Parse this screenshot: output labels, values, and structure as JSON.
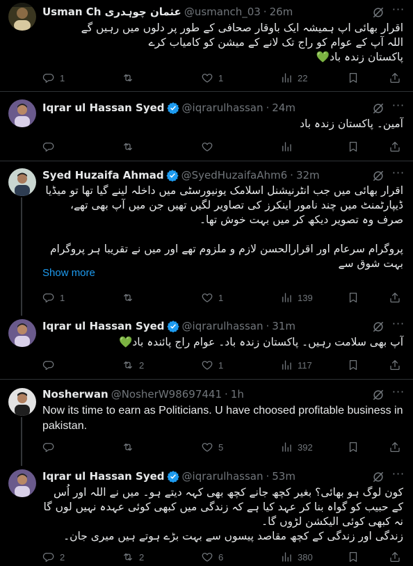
{
  "tweets": [
    {
      "name": "Usman Ch عثمان چوہدری",
      "handle": "@usmanch_03",
      "time": "26m",
      "verified": false,
      "lines": [
        "اقرار بھائی اپ ہمیشہ ایک باوقار صحافی کے طور پر دلوں میں رہیں گے",
        "اللہ آپ کے عوام کو راج تک لانے کے میشن کو کامیاب کرے",
        "پاکستان زندہ باد💚"
      ],
      "replies": "1",
      "retweets": "",
      "likes": "1",
      "views": "22"
    },
    {
      "name": "Iqrar ul Hassan Syed",
      "handle": "@iqrarulhassan",
      "time": "24m",
      "verified": true,
      "lines": [
        "آمین۔ پاکستان زندہ باد"
      ],
      "replies": "",
      "retweets": "",
      "likes": "",
      "views": ""
    },
    {
      "name": "Syed Huzaifa Ahmad",
      "handle": "@SyedHuzaifaAhm6",
      "time": "32m",
      "verified": true,
      "lines": [
        "اقرار بھائی میں جب انٹرنیشنل اسلامک یونیورسٹی میں داخلہ لینے گیا تھا تو میڈیا ڈیپارٹمنٹ میں چند نامور اینکرز کی تصاویر لگیں تھیں جن میں آپ بھی تھے، صرف وہ تصویر دیکھ کر میں بہت خوش تھا۔",
        "",
        "پروگرام سرعام اور اقرارالحسن لازم و ملزوم تھے اور میں نے تقریبا ہر پروگرام بہت شوق سے"
      ],
      "show_more": "Show more",
      "replies": "1",
      "retweets": "",
      "likes": "1",
      "views": "139"
    },
    {
      "name": "Iqrar ul Hassan Syed",
      "handle": "@iqrarulhassan",
      "time": "31m",
      "verified": true,
      "lines": [
        "آپ بھی سلامت رہیں۔ پاکستان زندہ باد۔ عوام راج پائندہ باد💚"
      ],
      "replies": "",
      "retweets": "2",
      "likes": "1",
      "views": "117"
    },
    {
      "name": "Nosherwan",
      "handle": "@NosherW98697441",
      "time": "1h",
      "verified": false,
      "lines": [
        "Now its time to earn as Politicians. U have choosed profitable business in pakistan."
      ],
      "replies": "",
      "retweets": "",
      "likes": "5",
      "views": "392"
    },
    {
      "name": "Iqrar ul Hassan Syed",
      "handle": "@iqrarulhassan",
      "time": "53m",
      "verified": true,
      "lines": [
        "کون لوگ ہو بھائی؟ بغیر کچھ جانے کچھ بھی کہہ دیتے ہو۔ میں نے اللہ اور اُس کے حبیب کو گواہ بنا کر عہد کیا ہے کہ زندگی میں کبھی کوئی عہدہ نہیں لوں گا نہ کبھی کوئی الیکشن لڑوں گا۔",
        "زندگی اور زندگی کے کچھ مقاصد پیسوں سے بہت بڑے ہوتے ہیں میری جان۔"
      ],
      "replies": "2",
      "retweets": "2",
      "likes": "6",
      "views": "380"
    }
  ],
  "colors": {
    "background": "#000000",
    "text": "#e7e9ea",
    "muted": "#71767b",
    "accent": "#1d9bf0",
    "separator": "#2f3336"
  },
  "icons": {
    "reply": "reply-icon",
    "retweet": "retweet-icon",
    "like": "heart-icon",
    "views": "views-icon",
    "bookmark": "bookmark-icon",
    "share": "share-icon",
    "grok": "grok-icon",
    "more": "more-icon",
    "verified": "verified-badge-icon"
  }
}
